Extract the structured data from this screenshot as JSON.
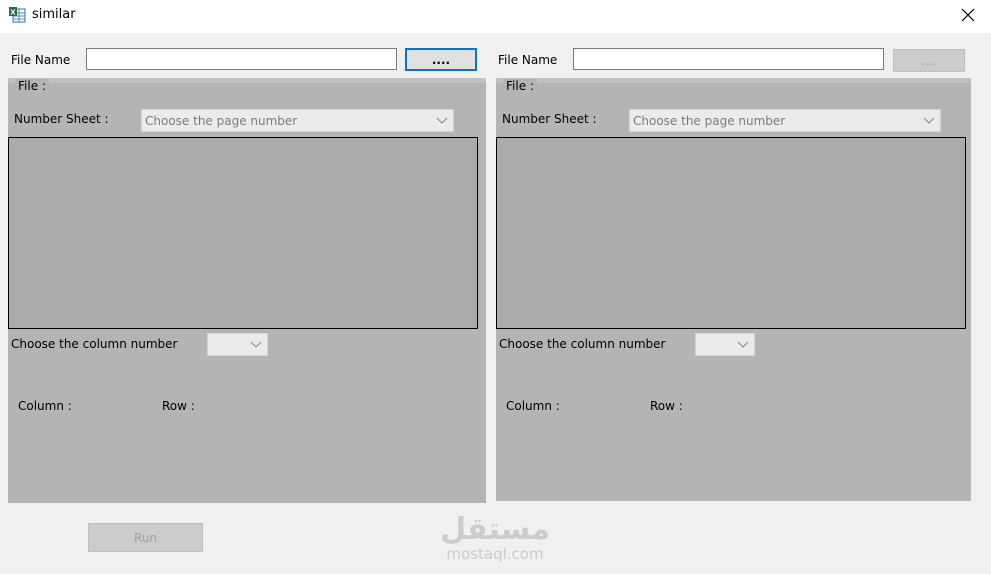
{
  "window": {
    "title": "similar",
    "close_glyph": "✕"
  },
  "left": {
    "file_name_label": "File Name",
    "file_name_value": "",
    "browse_label": "....",
    "group_label": "File :",
    "number_sheet_label": "Number Sheet :",
    "sheet_combo_text": "Choose the page number",
    "column_choose_label": "Choose the column number",
    "column_combo_text": "",
    "column_label": "Column :",
    "row_label": "Row :"
  },
  "right": {
    "file_name_label": "File Name",
    "file_name_value": "",
    "browse_label": "....",
    "group_label": "File :",
    "number_sheet_label": "Number Sheet :",
    "sheet_combo_text": "Choose the page number",
    "column_choose_label": "Choose the column number",
    "column_combo_text": "",
    "column_label": "Column :",
    "row_label": "Row :"
  },
  "run_label": "Run",
  "watermark": {
    "logo_text": "مستقل",
    "site_text": "mostaql.com"
  },
  "icons": {
    "app": "spreadsheet-icon",
    "close": "close-icon",
    "dropdown": "chevron-down-icon"
  }
}
